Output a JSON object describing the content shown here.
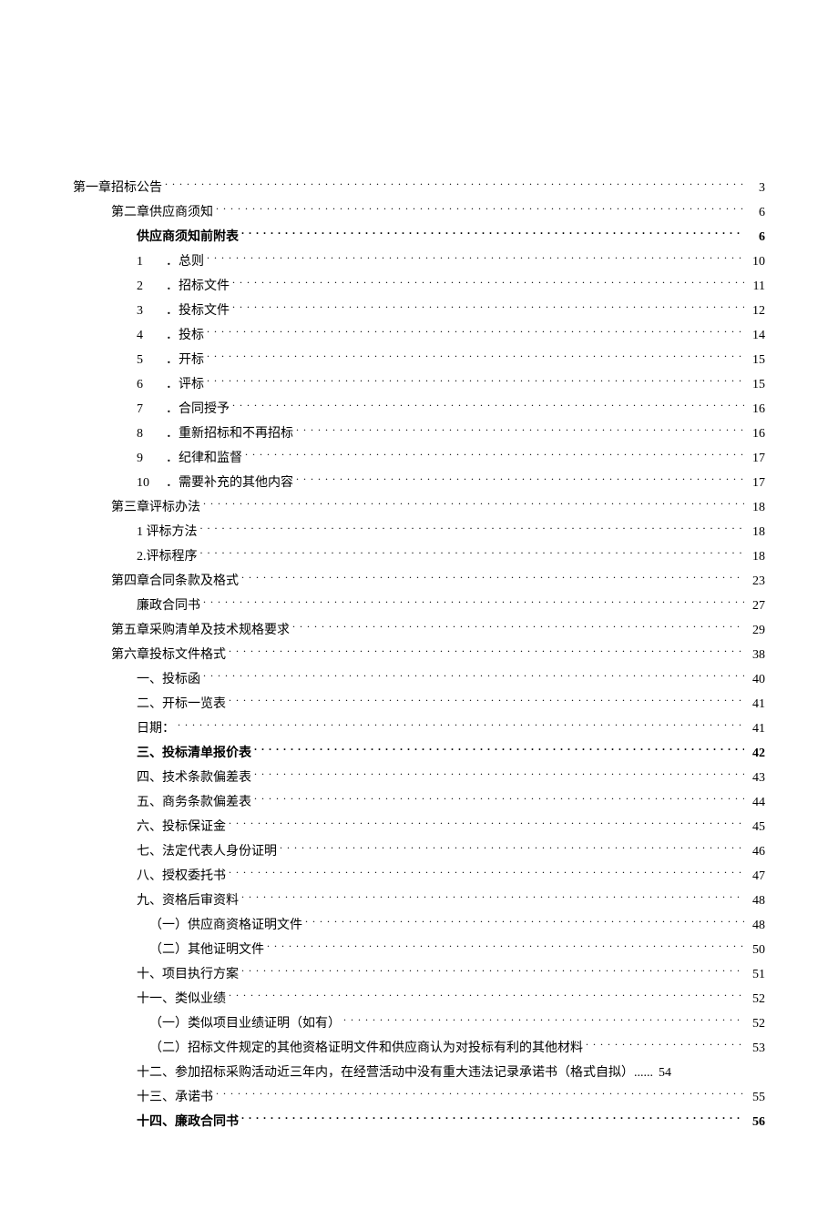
{
  "toc": [
    {
      "level": 0,
      "title": "第一章招标公告",
      "page": "3",
      "bold": false
    },
    {
      "level": 1,
      "title": "第二章供应商须知",
      "page": "6",
      "bold": false
    },
    {
      "level": 2,
      "title": "供应商须知前附表",
      "page": "6",
      "bold": true
    },
    {
      "level": 2,
      "num": "1",
      "title": "．总则",
      "page": "10",
      "bold": false
    },
    {
      "level": 2,
      "num": "2",
      "title": "．招标文件",
      "page": "11",
      "bold": false
    },
    {
      "level": 2,
      "num": "3",
      "title": "．投标文件",
      "page": "12",
      "bold": false
    },
    {
      "level": 2,
      "num": "4",
      "title": "．投标",
      "page": "14",
      "bold": false
    },
    {
      "level": 2,
      "num": "5",
      "title": "．开标",
      "page": "15",
      "bold": false
    },
    {
      "level": 2,
      "num": "6",
      "title": "．评标",
      "page": "15",
      "bold": false
    },
    {
      "level": 2,
      "num": "7",
      "title": "．合同授予",
      "page": "16",
      "bold": false
    },
    {
      "level": 2,
      "num": "8",
      "title": "．重新招标和不再招标",
      "page": "16",
      "bold": false
    },
    {
      "level": 2,
      "num": "9",
      "title": "．纪律和监督",
      "page": "17",
      "bold": false
    },
    {
      "level": 2,
      "num": "10",
      "title": "．需要补充的其他内容",
      "page": "17",
      "bold": false
    },
    {
      "level": 1,
      "title": "第三章评标办法",
      "page": "18",
      "bold": false
    },
    {
      "level": 2,
      "title": "1 评标方法",
      "page": "18",
      "bold": false
    },
    {
      "level": 2,
      "title": "2.评标程序",
      "page": "18",
      "bold": false
    },
    {
      "level": 1,
      "title": "第四章合同条款及格式",
      "page": "23",
      "bold": false
    },
    {
      "level": 2,
      "title": "廉政合同书",
      "page": "27",
      "bold": false
    },
    {
      "level": 1,
      "title": "第五章采购清单及技术规格要求",
      "page": "29",
      "bold": false
    },
    {
      "level": 1,
      "title": "第六章投标文件格式",
      "page": "38",
      "bold": false
    },
    {
      "level": 2,
      "title": "一、投标函",
      "page": "40",
      "bold": false
    },
    {
      "level": 2,
      "title": "二、开标一览表",
      "page": "41",
      "bold": false
    },
    {
      "level": 2,
      "title": "日期：",
      "page": "41",
      "bold": false
    },
    {
      "level": 2,
      "title": "三、投标清单报价表",
      "page": "42",
      "bold": true
    },
    {
      "level": 2,
      "title": "四、技术条款偏差表",
      "page": "43",
      "bold": false
    },
    {
      "level": 2,
      "title": "五、商务条款偏差表",
      "page": "44",
      "bold": false
    },
    {
      "level": 2,
      "title": "六、投标保证金",
      "page": "45",
      "bold": false
    },
    {
      "level": 2,
      "title": "七、法定代表人身份证明",
      "page": "46",
      "bold": false
    },
    {
      "level": 2,
      "title": "八、授权委托书",
      "page": "47",
      "bold": false
    },
    {
      "level": 2,
      "title": "九、资格后审资料",
      "page": "48",
      "bold": false
    },
    {
      "level": 3,
      "title": "（一）供应商资格证明文件",
      "page": "48",
      "bold": false
    },
    {
      "level": 3,
      "title": "（二）其他证明文件",
      "page": "50",
      "bold": false
    },
    {
      "level": 2,
      "title": "十、项目执行方案",
      "page": "51",
      "bold": false
    },
    {
      "level": 2,
      "title": "十一、类似业绩",
      "page": "52",
      "bold": false
    },
    {
      "level": 3,
      "title": "（一）类似项目业绩证明（如有）",
      "page": "52",
      "bold": false
    },
    {
      "level": 3,
      "title": "（二）招标文件规定的其他资格证明文件和供应商认为对投标有利的其他材料",
      "page": "53",
      "bold": false
    },
    {
      "level": 2,
      "title": "十二、参加招标采购活动近三年内，在经营活动中没有重大违法记录承诺书（格式自拟）",
      "page": "54",
      "bold": false,
      "nodots": true
    },
    {
      "level": 2,
      "title": "十三、承诺书",
      "page": "55",
      "bold": false
    },
    {
      "level": 2,
      "title": "十四、廉政合同书",
      "page": "56",
      "bold": true
    }
  ]
}
